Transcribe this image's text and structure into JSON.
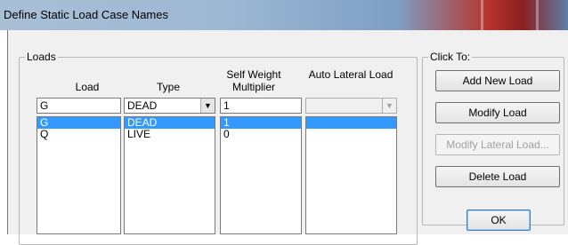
{
  "window": {
    "title": "Define Static Load Case Names"
  },
  "loads_group": {
    "label": "Loads",
    "headers": {
      "load": "Load",
      "type": "Type",
      "self_weight_multiplier": "Self Weight Multiplier",
      "auto_lateral_load": "Auto Lateral Load"
    },
    "edit_row": {
      "load": "G",
      "type": "DEAD",
      "multiplier": "1",
      "auto_lateral": ""
    },
    "rows": [
      {
        "load": "G",
        "type": "DEAD",
        "multiplier": "1",
        "auto_lateral": "",
        "selected": true
      },
      {
        "load": "Q",
        "type": "LIVE",
        "multiplier": "0",
        "auto_lateral": "",
        "selected": false
      }
    ]
  },
  "click_to_group": {
    "label": "Click To:",
    "buttons": {
      "add_new_load": "Add New Load",
      "modify_load": "Modify Load",
      "modify_lateral_load": "Modify Lateral Load...",
      "delete_load": "Delete Load"
    }
  },
  "ok_button": "OK",
  "colors": {
    "selection": "#3399ff",
    "dialog_bg": "#f0f0f0"
  },
  "icons": {
    "dropdown": "chevron-down-icon"
  }
}
